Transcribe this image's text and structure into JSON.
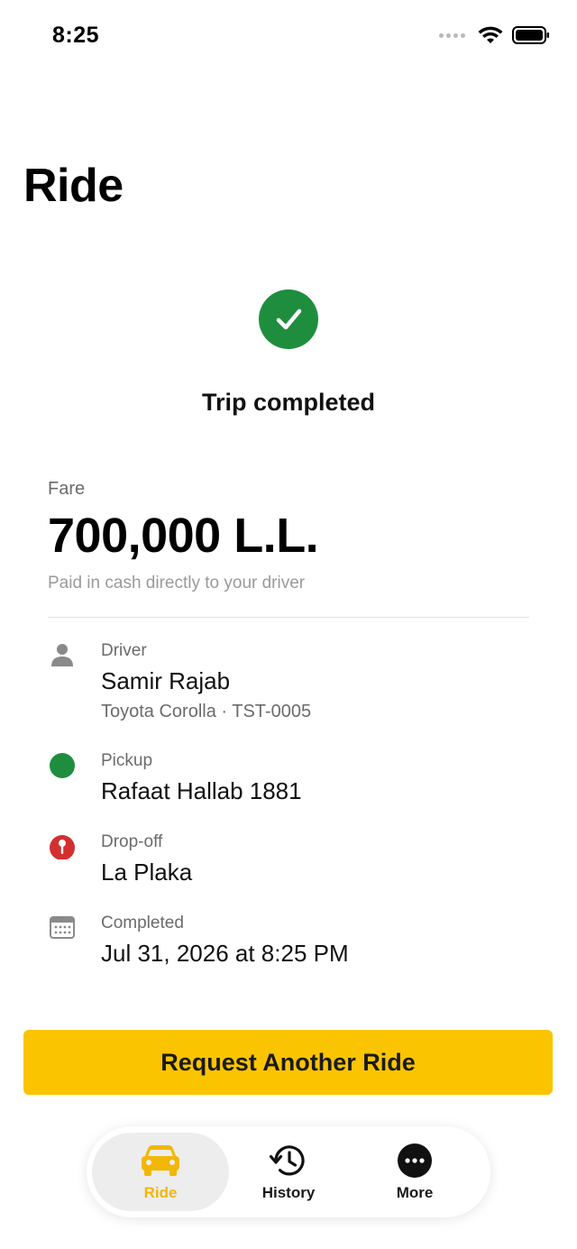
{
  "status_bar": {
    "time": "8:25"
  },
  "page": {
    "title": "Ride"
  },
  "trip": {
    "status": "Trip completed"
  },
  "fare": {
    "label": "Fare",
    "amount": "700,000 L.L.",
    "note": "Paid in cash directly to your driver"
  },
  "details": {
    "driver": {
      "label": "Driver",
      "name": "Samir Rajab",
      "vehicle": "Toyota Corolla · TST-0005"
    },
    "pickup": {
      "label": "Pickup",
      "value": "Rafaat Hallab 1881"
    },
    "dropoff": {
      "label": "Drop-off",
      "value": "La Plaka"
    },
    "completed": {
      "label": "Completed",
      "value": "Jul 31, 2026 at 8:25 PM"
    }
  },
  "actions": {
    "request_label": "Request Another Ride"
  },
  "tab_bar": {
    "tabs": [
      {
        "label": "Ride",
        "icon": "car-icon",
        "active": true
      },
      {
        "label": "History",
        "icon": "history-icon",
        "active": false
      },
      {
        "label": "More",
        "icon": "more-icon",
        "active": false
      }
    ]
  },
  "colors": {
    "accent": "#fbc400",
    "success": "#1e8e3e",
    "pickup_dot": "#1e8e3e",
    "dropoff_pin": "#d32f2f",
    "active_tab_text": "#f2b705"
  }
}
